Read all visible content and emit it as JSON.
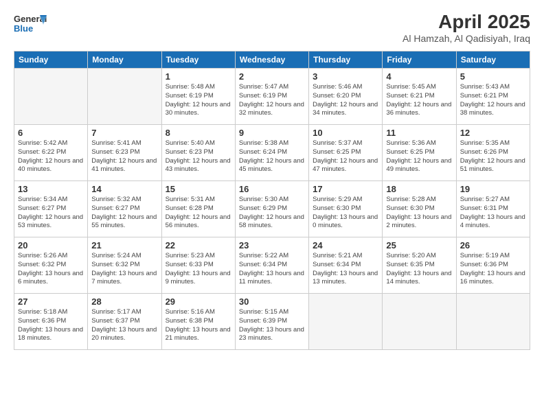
{
  "logo": {
    "line1": "General",
    "line2": "Blue"
  },
  "header": {
    "month": "April 2025",
    "location": "Al Hamzah, Al Qadisiyah, Iraq"
  },
  "weekdays": [
    "Sunday",
    "Monday",
    "Tuesday",
    "Wednesday",
    "Thursday",
    "Friday",
    "Saturday"
  ],
  "weeks": [
    [
      {
        "day": "",
        "empty": true
      },
      {
        "day": "",
        "empty": true
      },
      {
        "day": "1",
        "sunrise": "5:48 AM",
        "sunset": "6:19 PM",
        "daylight": "12 hours and 30 minutes."
      },
      {
        "day": "2",
        "sunrise": "5:47 AM",
        "sunset": "6:19 PM",
        "daylight": "12 hours and 32 minutes."
      },
      {
        "day": "3",
        "sunrise": "5:46 AM",
        "sunset": "6:20 PM",
        "daylight": "12 hours and 34 minutes."
      },
      {
        "day": "4",
        "sunrise": "5:45 AM",
        "sunset": "6:21 PM",
        "daylight": "12 hours and 36 minutes."
      },
      {
        "day": "5",
        "sunrise": "5:43 AM",
        "sunset": "6:21 PM",
        "daylight": "12 hours and 38 minutes."
      }
    ],
    [
      {
        "day": "6",
        "sunrise": "5:42 AM",
        "sunset": "6:22 PM",
        "daylight": "12 hours and 40 minutes."
      },
      {
        "day": "7",
        "sunrise": "5:41 AM",
        "sunset": "6:23 PM",
        "daylight": "12 hours and 41 minutes."
      },
      {
        "day": "8",
        "sunrise": "5:40 AM",
        "sunset": "6:23 PM",
        "daylight": "12 hours and 43 minutes."
      },
      {
        "day": "9",
        "sunrise": "5:38 AM",
        "sunset": "6:24 PM",
        "daylight": "12 hours and 45 minutes."
      },
      {
        "day": "10",
        "sunrise": "5:37 AM",
        "sunset": "6:25 PM",
        "daylight": "12 hours and 47 minutes."
      },
      {
        "day": "11",
        "sunrise": "5:36 AM",
        "sunset": "6:25 PM",
        "daylight": "12 hours and 49 minutes."
      },
      {
        "day": "12",
        "sunrise": "5:35 AM",
        "sunset": "6:26 PM",
        "daylight": "12 hours and 51 minutes."
      }
    ],
    [
      {
        "day": "13",
        "sunrise": "5:34 AM",
        "sunset": "6:27 PM",
        "daylight": "12 hours and 53 minutes."
      },
      {
        "day": "14",
        "sunrise": "5:32 AM",
        "sunset": "6:27 PM",
        "daylight": "12 hours and 55 minutes."
      },
      {
        "day": "15",
        "sunrise": "5:31 AM",
        "sunset": "6:28 PM",
        "daylight": "12 hours and 56 minutes."
      },
      {
        "day": "16",
        "sunrise": "5:30 AM",
        "sunset": "6:29 PM",
        "daylight": "12 hours and 58 minutes."
      },
      {
        "day": "17",
        "sunrise": "5:29 AM",
        "sunset": "6:30 PM",
        "daylight": "13 hours and 0 minutes."
      },
      {
        "day": "18",
        "sunrise": "5:28 AM",
        "sunset": "6:30 PM",
        "daylight": "13 hours and 2 minutes."
      },
      {
        "day": "19",
        "sunrise": "5:27 AM",
        "sunset": "6:31 PM",
        "daylight": "13 hours and 4 minutes."
      }
    ],
    [
      {
        "day": "20",
        "sunrise": "5:26 AM",
        "sunset": "6:32 PM",
        "daylight": "13 hours and 6 minutes."
      },
      {
        "day": "21",
        "sunrise": "5:24 AM",
        "sunset": "6:32 PM",
        "daylight": "13 hours and 7 minutes."
      },
      {
        "day": "22",
        "sunrise": "5:23 AM",
        "sunset": "6:33 PM",
        "daylight": "13 hours and 9 minutes."
      },
      {
        "day": "23",
        "sunrise": "5:22 AM",
        "sunset": "6:34 PM",
        "daylight": "13 hours and 11 minutes."
      },
      {
        "day": "24",
        "sunrise": "5:21 AM",
        "sunset": "6:34 PM",
        "daylight": "13 hours and 13 minutes."
      },
      {
        "day": "25",
        "sunrise": "5:20 AM",
        "sunset": "6:35 PM",
        "daylight": "13 hours and 14 minutes."
      },
      {
        "day": "26",
        "sunrise": "5:19 AM",
        "sunset": "6:36 PM",
        "daylight": "13 hours and 16 minutes."
      }
    ],
    [
      {
        "day": "27",
        "sunrise": "5:18 AM",
        "sunset": "6:36 PM",
        "daylight": "13 hours and 18 minutes."
      },
      {
        "day": "28",
        "sunrise": "5:17 AM",
        "sunset": "6:37 PM",
        "daylight": "13 hours and 20 minutes."
      },
      {
        "day": "29",
        "sunrise": "5:16 AM",
        "sunset": "6:38 PM",
        "daylight": "13 hours and 21 minutes."
      },
      {
        "day": "30",
        "sunrise": "5:15 AM",
        "sunset": "6:39 PM",
        "daylight": "13 hours and 23 minutes."
      },
      {
        "day": "",
        "empty": true
      },
      {
        "day": "",
        "empty": true
      },
      {
        "day": "",
        "empty": true
      }
    ]
  ],
  "labels": {
    "sunrise_prefix": "Sunrise: ",
    "sunset_prefix": "Sunset: ",
    "daylight_prefix": "Daylight: "
  }
}
